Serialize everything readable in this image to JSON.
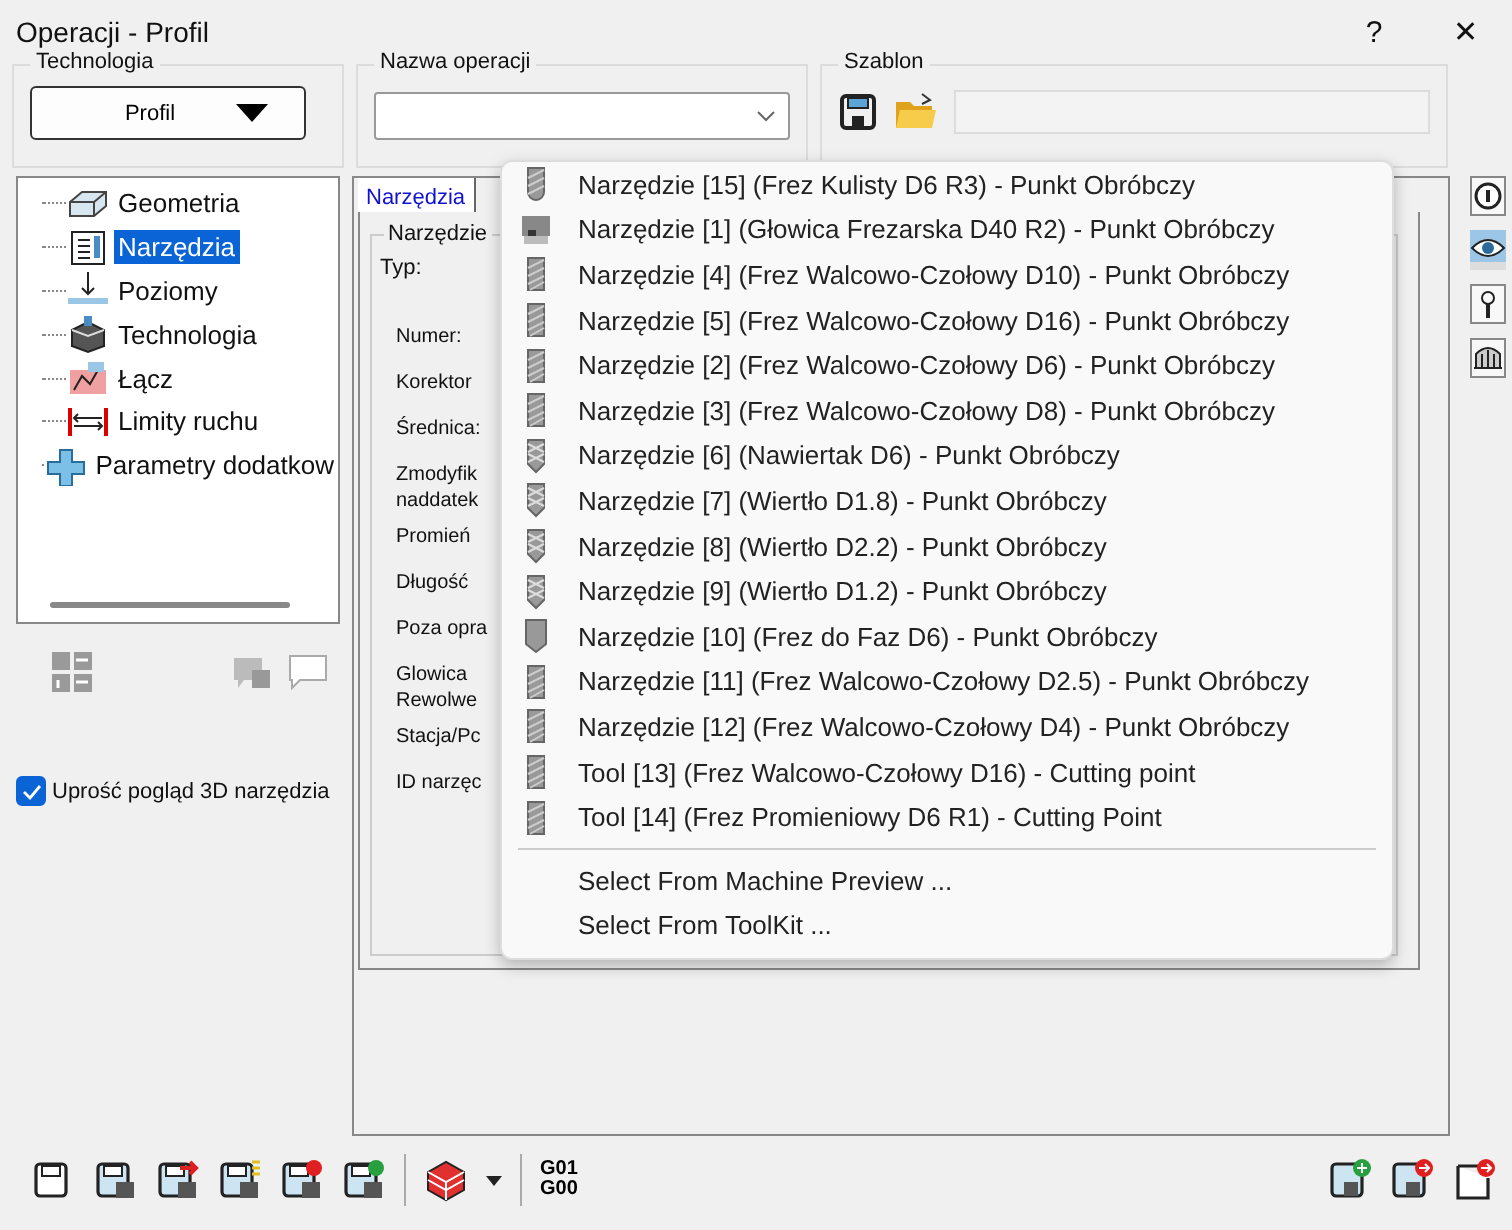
{
  "window": {
    "title": "Operacji - Profil",
    "help": "?",
    "close": "✕"
  },
  "technology": {
    "label": "Technologia",
    "value": "Profil"
  },
  "operation_name": {
    "label": "Nazwa operacji"
  },
  "template": {
    "label": "Szablon"
  },
  "tree": {
    "items": [
      {
        "label": "Geometria",
        "kind": "geometry",
        "selected": false
      },
      {
        "label": "Narzędzia",
        "kind": "tools",
        "selected": true
      },
      {
        "label": "Poziomy",
        "kind": "levels",
        "selected": false
      },
      {
        "label": "Technologia",
        "kind": "technology",
        "selected": false
      },
      {
        "label": "Łącz",
        "kind": "link",
        "selected": false
      },
      {
        "label": "Limity ruchu",
        "kind": "limits",
        "selected": false
      },
      {
        "label": "Parametry dodatkow",
        "kind": "params",
        "selected": false
      }
    ]
  },
  "tabs": [
    {
      "label": "Narzędzia",
      "selected": true
    }
  ],
  "tool_group": {
    "label": "Narzędzie",
    "fields": [
      {
        "label": "Typ:"
      },
      {
        "label": "Numer:"
      },
      {
        "label": "Korektor"
      },
      {
        "label": "Średnica:"
      },
      {
        "label": "Zmodyfik\nnaddatek"
      },
      {
        "label": "Promień"
      },
      {
        "label": "Długość"
      },
      {
        "label": "Poza opra"
      },
      {
        "label": "Glowica\nRewolwe"
      },
      {
        "label": "Stacja/Pc"
      },
      {
        "label": "ID narzęc"
      }
    ]
  },
  "tool_menu": {
    "items": [
      {
        "label": "Narzędzie [15] (Frez Kulisty D6 R3) - Punkt Obróbczy",
        "kind": "ball"
      },
      {
        "label": "Narzędzie [1] (Głowica Frezarska D40 R2) - Punkt Obróbczy",
        "kind": "head"
      },
      {
        "label": "Narzędzie [4] (Frez Walcowo-Czołowy D10) - Punkt Obróbczy",
        "kind": "flat"
      },
      {
        "label": "Narzędzie [5] (Frez Walcowo-Czołowy D16) - Punkt Obróbczy",
        "kind": "flat"
      },
      {
        "label": "Narzędzie [2] (Frez Walcowo-Czołowy D6) - Punkt Obróbczy",
        "kind": "flat"
      },
      {
        "label": "Narzędzie [3] (Frez Walcowo-Czołowy D8) - Punkt Obróbczy",
        "kind": "flat"
      },
      {
        "label": "Narzędzie [6] (Nawiertak D6) - Punkt Obróbczy",
        "kind": "drill"
      },
      {
        "label": "Narzędzie [7] (Wiertło D1.8) - Punkt Obróbczy",
        "kind": "drill"
      },
      {
        "label": "Narzędzie [8] (Wiertło D2.2) - Punkt Obróbczy",
        "kind": "drill"
      },
      {
        "label": "Narzędzie [9] (Wiertło D1.2) - Punkt Obróbczy",
        "kind": "drill"
      },
      {
        "label": "Narzędzie [10] (Frez do Faz D6) - Punkt Obróbczy",
        "kind": "chamfer"
      },
      {
        "label": "Narzędzie [11] (Frez Walcowo-Czołowy D2.5) - Punkt Obróbczy",
        "kind": "flat"
      },
      {
        "label": "Narzędzie [12] (Frez Walcowo-Czołowy D4) - Punkt Obróbczy",
        "kind": "flat"
      },
      {
        "label": "Tool [13] (Frez Walcowo-Czołowy D16) - Cutting point",
        "kind": "flat"
      },
      {
        "label": "Tool [14] (Frez Promieniowy D6 R1) - Cutting Point",
        "kind": "flat"
      }
    ],
    "actions": [
      {
        "label": "Select From Machine Preview ..."
      },
      {
        "label": "Select From ToolKit ..."
      }
    ]
  },
  "simplify_3d": {
    "label": "Uprość pogląd 3D narzędzia",
    "checked": true
  },
  "toolbar": {
    "gcode": "G01\nG00"
  }
}
